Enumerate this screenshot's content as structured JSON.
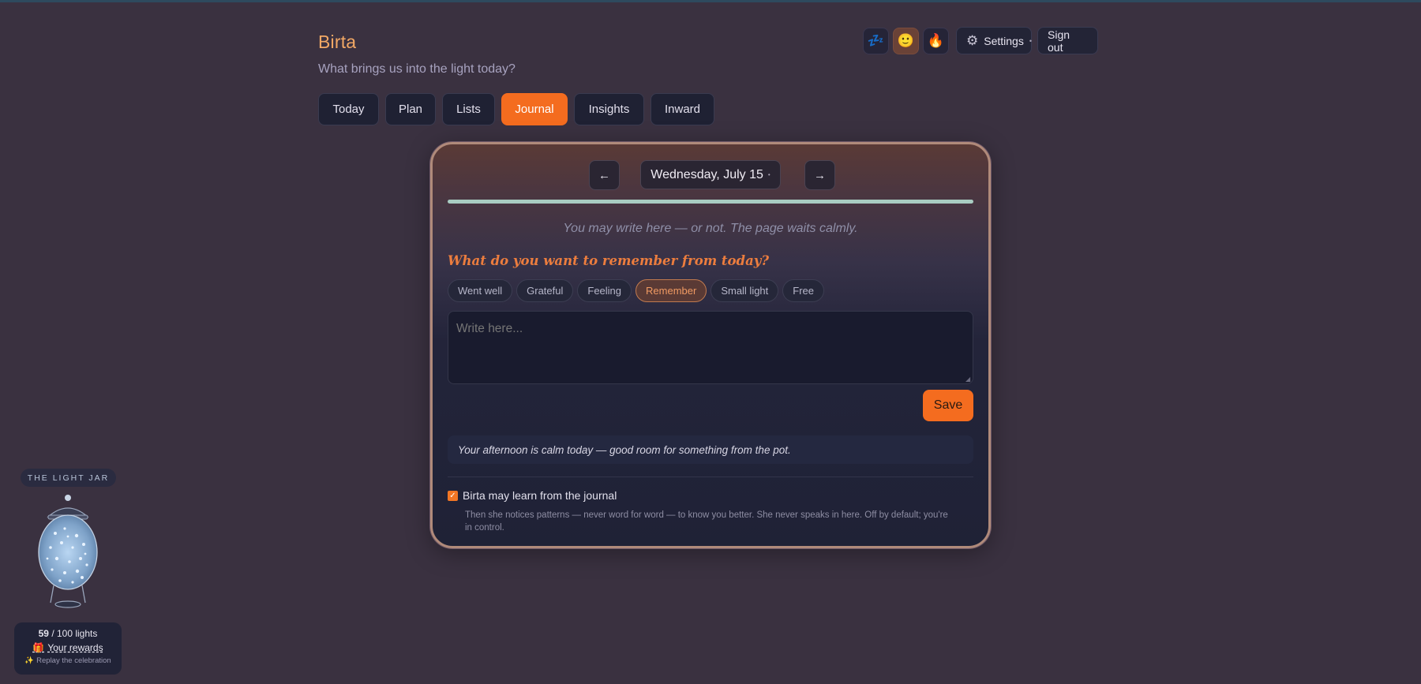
{
  "app": {
    "title": "Birta",
    "tagline": "What brings us into the light today?"
  },
  "header": {
    "mood_buttons": [
      {
        "emoji": "💤",
        "icon": "sleep-icon",
        "active": false
      },
      {
        "emoji": "🙂",
        "icon": "smile-icon",
        "active": true
      },
      {
        "emoji": "🔥",
        "icon": "fire-icon",
        "active": false
      }
    ],
    "settings_label": "Settings",
    "signout_label": "Sign out"
  },
  "tabs": [
    "Today",
    "Plan",
    "Lists",
    "Journal",
    "Insights",
    "Inward"
  ],
  "active_tab": "Journal",
  "journal": {
    "date_label": "Wednesday, July 15",
    "progress_fraction": 1.0,
    "hint": "You may write here — or not. The page waits calmly.",
    "prompt": "What do you want to remember from today?",
    "chips": [
      "Went well",
      "Grateful",
      "Feeling",
      "Remember",
      "Small light",
      "Free"
    ],
    "active_chip": "Remember",
    "textarea_placeholder": "Write here...",
    "save_label": "Save",
    "note": "Your afternoon is calm today — good room for something from the pot.",
    "consent_checked": true,
    "consent_label": "Birta may learn from the journal",
    "consent_desc": "Then she notices patterns — never word for word — to know you better. She never speaks in here. Off by default; you're in control."
  },
  "light_jar": {
    "title": "THE LIGHT JAR",
    "count": "59",
    "count_suffix": " / 100 lights",
    "rewards_label": "Your rewards",
    "replay_label": "Replay the celebration"
  },
  "colors": {
    "accent": "#f46c1f",
    "brand": "#f2a865",
    "background": "#3a3140"
  }
}
